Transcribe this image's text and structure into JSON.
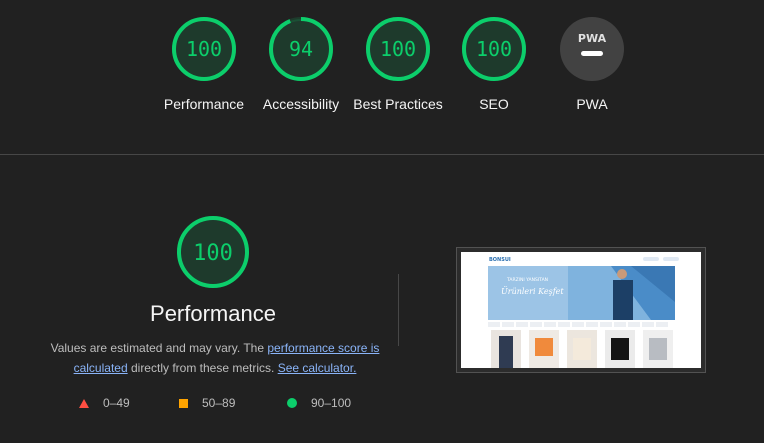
{
  "scores": [
    {
      "id": "performance",
      "score": "100",
      "label": "Performance",
      "value": 100
    },
    {
      "id": "accessibility",
      "score": "94",
      "label": "Accessibility",
      "value": 94
    },
    {
      "id": "best-practices",
      "score": "100",
      "label": "Best Practices",
      "value": 100
    },
    {
      "id": "seo",
      "score": "100",
      "label": "SEO",
      "value": 100
    },
    {
      "id": "pwa",
      "badge": "PWA",
      "label": "PWA"
    }
  ],
  "performance": {
    "score": "100",
    "title": "Performance",
    "desc_prefix": "Values are estimated and may vary. The ",
    "link_score": "performance score is calculated",
    "desc_mid": " directly from these metrics. ",
    "link_calc": "See calculator."
  },
  "legend": [
    {
      "range": "0–49",
      "icon": "triangle-icon",
      "color": "#ff4e42"
    },
    {
      "range": "50–89",
      "icon": "square-icon",
      "color": "#ffa400"
    },
    {
      "range": "90–100",
      "icon": "circle-icon",
      "color": "#0cce6b"
    }
  ],
  "screenshot": {
    "brand": "BONSUI",
    "hero_line1": "TARZINI YANSITAN",
    "hero_line2": "Ürünleri Keşfet"
  },
  "colors": {
    "pass": "#0cce6b",
    "average": "#ffa400",
    "fail": "#ff4e42",
    "background": "#212121"
  }
}
